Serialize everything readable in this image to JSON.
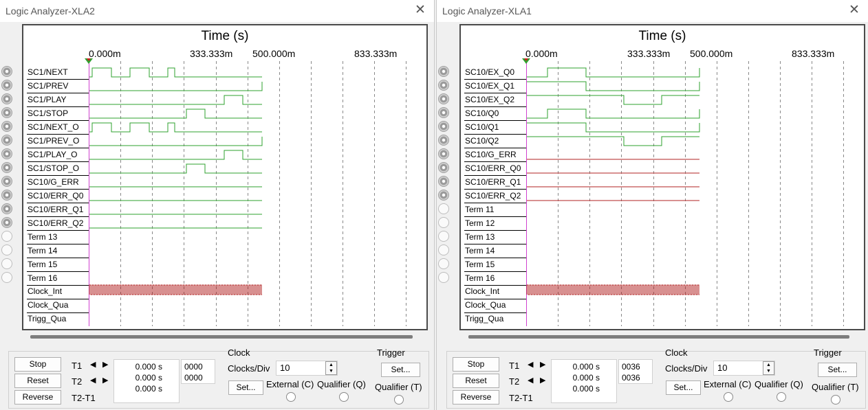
{
  "colors": {
    "signal_green": "#2ca02c",
    "signal_red": "#b02020",
    "cursor_magenta": "#d040d0",
    "cursor_marker_green": "#30a030",
    "cursor_marker_red": "#d02020"
  },
  "left": {
    "title": "Logic Analyzer-XLA2",
    "close_icon": "✕",
    "plot_title": "Time (s)",
    "time_labels": [
      "0.000m",
      "333.333m",
      "500.000m",
      "833.333m"
    ],
    "signals": [
      "SC1/NEXT",
      "SC1/PREV",
      "SC1/PLAY",
      "SC1/STOP",
      "SC1/NEXT_O",
      "SC1/PREV_O",
      "SC1/PLAY_O",
      "SC1/STOP_O",
      "SC10/G_ERR",
      "SC10/ERR_Q0",
      "SC10/ERR_Q1",
      "SC10/ERR_Q2",
      "Term 13",
      "Term 14",
      "Term 15",
      "Term 16",
      "Clock_Int",
      "Clock_Qua",
      "Trigg_Qua"
    ],
    "buttons": {
      "stop": "Stop",
      "reset": "Reset",
      "reverse": "Reverse"
    },
    "cursor": {
      "t1": "T1",
      "t2": "T2",
      "t2t1": "T2-T1",
      "t1_value": "0.000 s",
      "t2_value": "0.000 s",
      "t2t1_value": "0.000 s",
      "t1_hex": "0000",
      "t2_hex": "0000"
    },
    "clock": {
      "title": "Clock",
      "clocks_div_label": "Clocks/Div",
      "clocks_div_value": "10",
      "set": "Set...",
      "external": "External (C)",
      "qualifier": "Qualifier (Q)"
    },
    "trigger": {
      "title": "Trigger",
      "set": "Set...",
      "qualifier": "Qualifier (T)"
    }
  },
  "right": {
    "title": "Logic Analyzer-XLA1",
    "close_icon": "✕",
    "plot_title": "Time (s)",
    "time_labels": [
      "0.000m",
      "333.333m",
      "500.000m",
      "833.333m"
    ],
    "signals": [
      "SC10/EX_Q0",
      "SC10/EX_Q1",
      "SC10/EX_Q2",
      "SC10/Q0",
      "SC10/Q1",
      "SC10/Q2",
      "SC10/G_ERR",
      "SC10/ERR_Q0",
      "SC10/ERR_Q1",
      "SC10/ERR_Q2",
      "Term 11",
      "Term 12",
      "Term 13",
      "Term 14",
      "Term 15",
      "Term 16",
      "Clock_Int",
      "Clock_Qua",
      "Trigg_Qua"
    ],
    "buttons": {
      "stop": "Stop",
      "reset": "Reset",
      "reverse": "Reverse"
    },
    "cursor": {
      "t1": "T1",
      "t2": "T2",
      "t2t1": "T2-T1",
      "t1_value": "0.000 s",
      "t2_value": "0.000 s",
      "t2t1_value": "0.000 s",
      "t1_hex": "0036",
      "t2_hex": "0036"
    },
    "clock": {
      "title": "Clock",
      "clocks_div_label": "Clocks/Div",
      "clocks_div_value": "10",
      "set": "Set...",
      "external": "External (C)",
      "qualifier": "Qualifier (Q)"
    },
    "trigger": {
      "title": "Trigger",
      "set": "Set...",
      "qualifier": "Qualifier (T)"
    }
  }
}
